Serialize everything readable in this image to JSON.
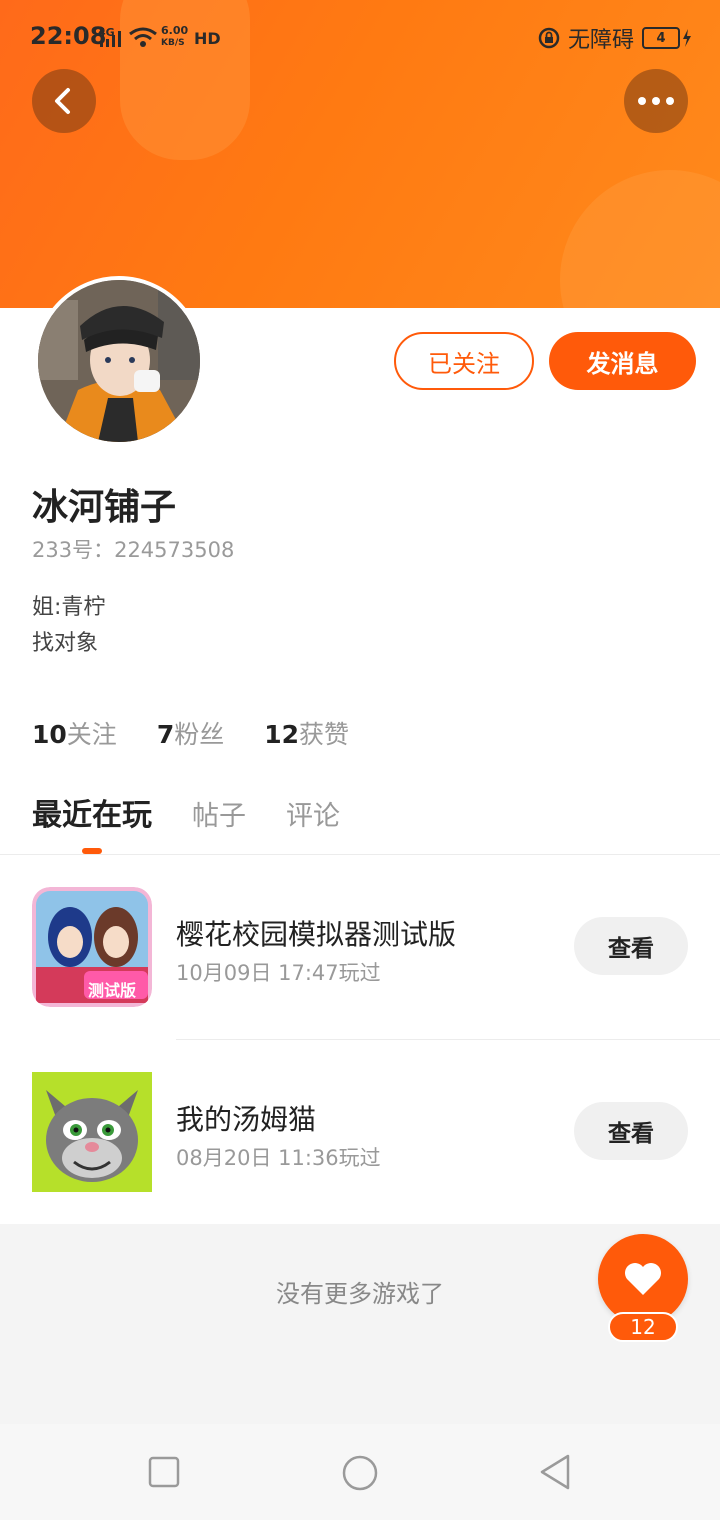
{
  "status_bar": {
    "time": "22:08",
    "network": "4G",
    "speed_value": "6.00",
    "speed_unit": "KB/S",
    "hd": "HD",
    "accessibility": "无障碍",
    "battery": "4"
  },
  "header": {
    "back_icon": "chevron-left-icon",
    "more_icon": "more-dots-icon",
    "colors": {
      "gradient_start": "#ff6a1a",
      "gradient_end": "#ff8a1c"
    }
  },
  "profile": {
    "name": "冰河铺子",
    "id_line": "233号：224573508",
    "bio": [
      "姐:青柠",
      "找对象"
    ],
    "follow_button": "已关注",
    "message_button": "发消息"
  },
  "stats": [
    {
      "count": "10",
      "label": "关注"
    },
    {
      "count": "7",
      "label": "粉丝"
    },
    {
      "count": "12",
      "label": "获赞"
    }
  ],
  "tabs": [
    {
      "label": "最近在玩",
      "active": true
    },
    {
      "label": "帖子",
      "active": false
    },
    {
      "label": "评论",
      "active": false
    }
  ],
  "games": [
    {
      "title": "樱花校园模拟器测试版",
      "played": "10月09日 17:47玩过",
      "action": "查看",
      "badge": "测试版"
    },
    {
      "title": "我的汤姆猫",
      "played": "08月20日 11:36玩过",
      "action": "查看"
    }
  ],
  "footer_text": "没有更多游戏了",
  "like_fab": {
    "icon": "heart-icon",
    "count": "12"
  },
  "accent_color": "#ff5a0a"
}
